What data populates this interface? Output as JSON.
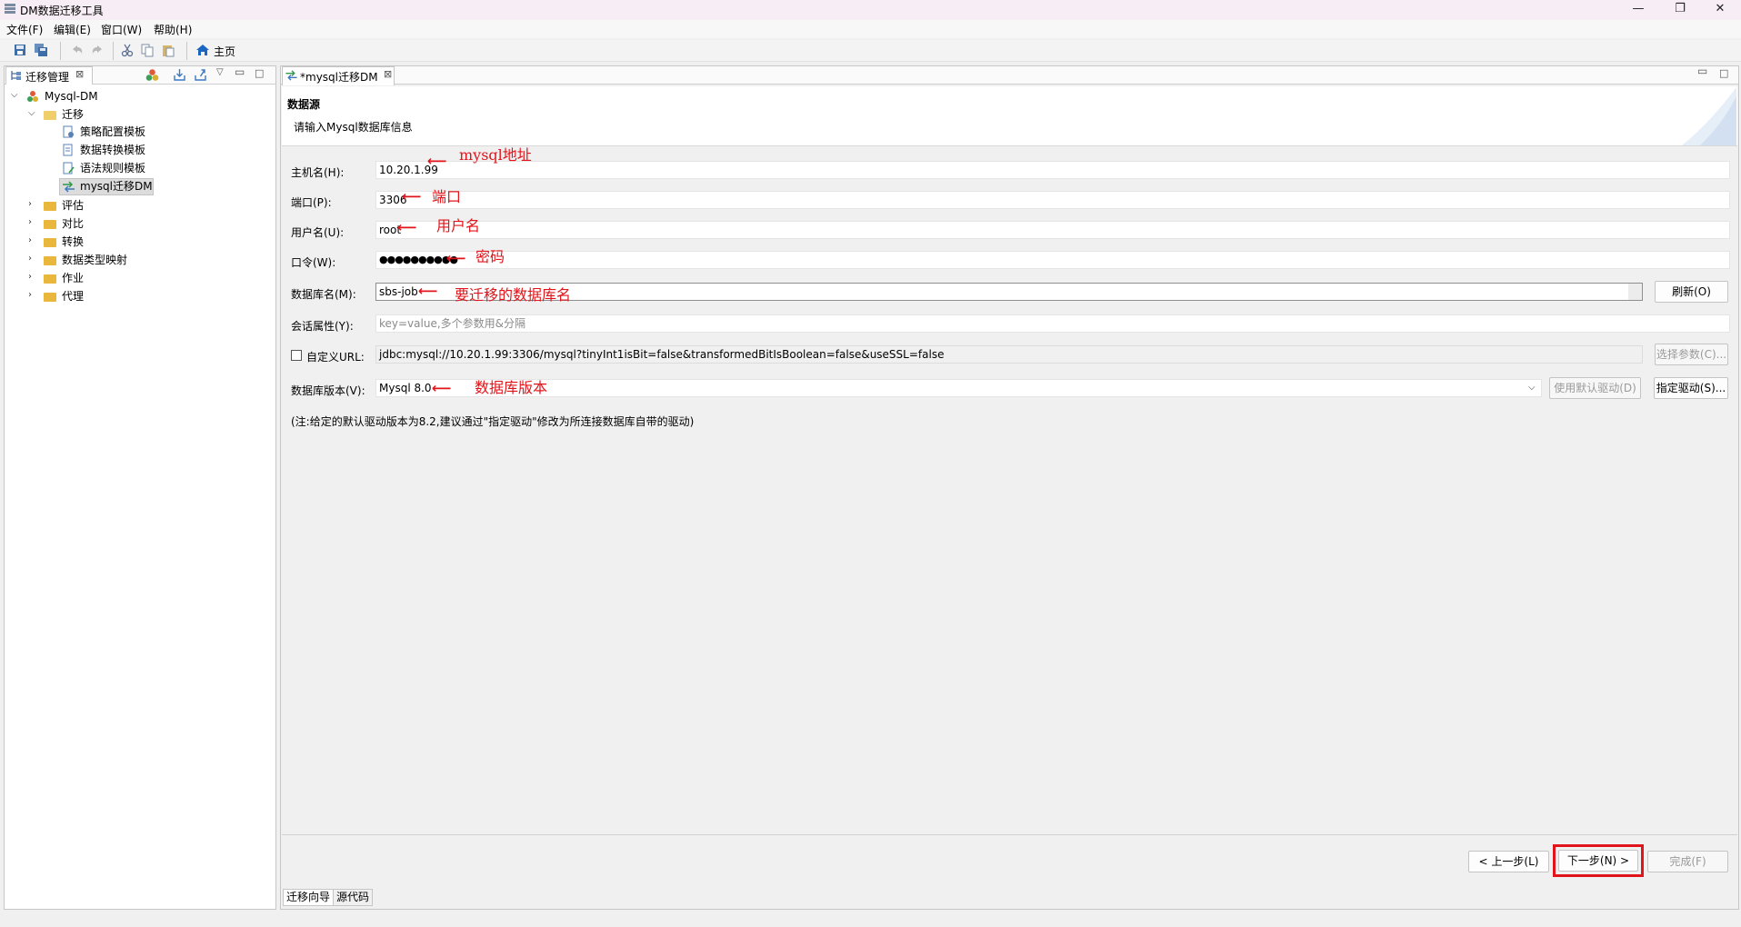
{
  "window": {
    "title": "DM数据迁移工具",
    "minimize": "—",
    "restore": "❐",
    "close": "✕"
  },
  "menu": [
    "文件(F)",
    "编辑(E)",
    "窗口(W)",
    "帮助(H)"
  ],
  "toolbar": {
    "home_label": "主页"
  },
  "left_panel": {
    "tab_label": "迁移管理",
    "tree": {
      "root": "Mysql-DM",
      "migrate": "迁移",
      "migrate_children": [
        "策略配置模板",
        "数据转换模板",
        "语法规则模板",
        "mysql迁移DM"
      ],
      "others": [
        "评估",
        "对比",
        "转换",
        "数据类型映射",
        "作业",
        "代理"
      ]
    }
  },
  "editor": {
    "tab_label": "*mysql迁移DM",
    "header_title": "数据源",
    "header_desc": "请输入Mysql数据库信息",
    "fields": {
      "host_label": "主机名(H):",
      "host_value": "10.20.1.99",
      "port_label": "端口(P):",
      "port_value": "3306",
      "user_label": "用户名(U):",
      "user_value": "root",
      "password_label": "口令(W):",
      "password_value": "●●●●●●●●●●",
      "dbname_label": "数据库名(M):",
      "dbname_value": "sbs-job",
      "refresh_button": "刷新(O)",
      "session_label": "会话属性(Y):",
      "session_placeholder": "key=value,多个参数用&分隔",
      "custom_url_label": "自定义URL:",
      "url_value": "jdbc:mysql://10.20.1.99:3306/mysql?tinyInt1isBit=false&transformedBitIsBoolean=false&useSSL=false",
      "select_params_button": "选择参数(C)...",
      "version_label": "数据库版本(V):",
      "version_value": "Mysql 8.0",
      "default_driver_button": "使用默认驱动(D)",
      "specify_driver_button": "指定驱动(S)...",
      "note": "(注:给定的默认驱动版本为8.2,建议通过\"指定驱动\"修改为所连接数据库自带的驱动)"
    },
    "nav": {
      "prev": "< 上一步(L)",
      "next": "下一步(N) >",
      "finish": "完成(F)"
    },
    "bottom_tabs": [
      "迁移向导",
      "源代码"
    ]
  },
  "annotations": {
    "host": "mysql地址",
    "port": "端口",
    "user": "用户名",
    "password": "密码",
    "dbname": "要迁移的数据库名",
    "version": "数据库版本"
  },
  "colors": {
    "annotation": "#e0141a",
    "highlight_box": "#e0141a",
    "folder": "#e8b73c",
    "home_icon": "#1a66c2"
  }
}
